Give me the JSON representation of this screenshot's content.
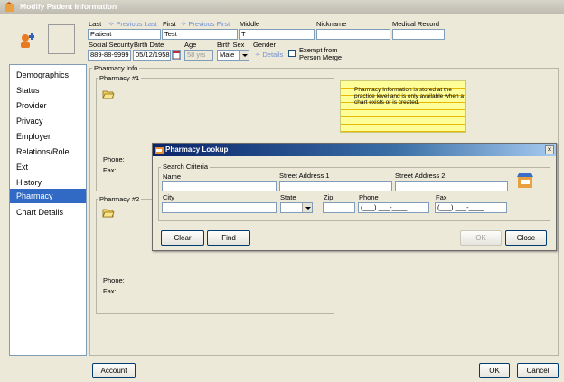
{
  "window": {
    "title": "Modify Patient Information"
  },
  "header": {
    "last_label": "Last",
    "prev_last_link": "Previous Last",
    "first_label": "First",
    "prev_first_link": "Previous First",
    "middle_label": "Middle",
    "nickname_label": "Nickname",
    "medical_record_label": "Medical Record",
    "last_value": "Patient",
    "first_value": "Test",
    "middle_value": "T",
    "nickname_value": "",
    "medical_record_value": "",
    "ssn_label": "Social Security",
    "birthdate_label": "Birth Date",
    "age_label": "Age",
    "birthsex_label": "Birth Sex",
    "gender_label": "Gender",
    "ssn_value": "889-88-9999",
    "birthdate_value": "05/12/1958",
    "age_value": "58 yrs",
    "birthsex_value": "Male",
    "details_link": "Details",
    "exempt_label_1": "Exempt from",
    "exempt_label_2": "Person Merge"
  },
  "sidebar": {
    "items": [
      {
        "label": "Demographics"
      },
      {
        "label": "Status"
      },
      {
        "label": "Provider"
      },
      {
        "label": "Privacy"
      },
      {
        "label": "Employer"
      },
      {
        "label": "Relations/Role"
      },
      {
        "label": "Ext"
      },
      {
        "label": "History"
      },
      {
        "label": "Pharmacy"
      },
      {
        "label": "Chart Details"
      }
    ]
  },
  "main": {
    "pharmacy_info_legend": "Pharmacy Info",
    "pharmacy1_legend": "Pharmacy #1",
    "pharmacy2_legend": "Pharmacy #2",
    "phone_label": "Phone:",
    "fax_label": "Fax:",
    "note_text": "Pharmacy Information is stored at the practice level and is only available when a chart exists or is created."
  },
  "dialog": {
    "title": "Pharmacy Lookup",
    "criteria_legend": "Search Criteria",
    "name_label": "Name",
    "street1_label": "Street Address 1",
    "street2_label": "Street Address 2",
    "city_label": "City",
    "state_label": "State",
    "zip_label": "Zip",
    "phone_label": "Phone",
    "fax_label": "Fax",
    "phone_mask": "(___) ___-____",
    "fax_mask": "(___) ___-____",
    "clear_button": "Clear",
    "find_button": "Find",
    "ok_button": "OK",
    "close_button": "Close"
  },
  "footer": {
    "account_button": "Account",
    "ok_button": "OK",
    "cancel_button": "Cancel"
  },
  "colors": {
    "selection": "#316ac5",
    "link": "#6f8fd6",
    "note": "#ffff99",
    "dialog_title": "#0a246a"
  }
}
